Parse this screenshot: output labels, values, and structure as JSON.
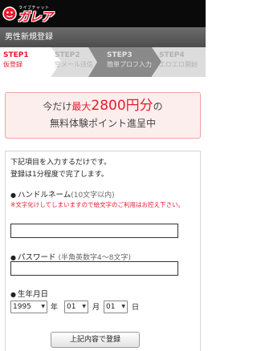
{
  "header": {
    "logo_sub": "ライブチャット",
    "logo_text": "ガレア"
  },
  "title_bar": {
    "title": "男性新規登録"
  },
  "steps": [
    {
      "num": "STEP1",
      "label": "仮登録"
    },
    {
      "num": "STEP2",
      "label": "空メール送信"
    },
    {
      "num": "STEP3",
      "label": "簡単プロフ入力"
    },
    {
      "num": "STEP4",
      "label": "エロエロ開始"
    }
  ],
  "promo": {
    "prefix": "今だけ",
    "max": "最大",
    "amount": "2800円分",
    "suffix": "の",
    "line2": "無料体験ポイント進呈中"
  },
  "form": {
    "intro_line1": "下記項目を入力するだけです。",
    "intro_line2": "登録は1分程度で完了します。",
    "handle_label": "ハンドルネーム",
    "handle_hint": "(10文字以内)",
    "handle_note": "※文字化けしてしまいますので絵文字のご利用はお控え下さい。",
    "handle_value": "",
    "password_label": "パスワード",
    "password_hint": "(半角英数字4〜8文字)",
    "password_value": "",
    "birth_label": "生年月日",
    "birth_year": "1995",
    "birth_year_unit": "年",
    "birth_month": "01",
    "birth_month_unit": "月",
    "birth_day": "01",
    "birth_day_unit": "日",
    "submit_label": "上記内容で登録"
  },
  "colors": {
    "accent": "#e8192c",
    "header_bg": "#0a0a0a",
    "title_bar_bg": "#5a5a5a",
    "promo_bg": "#fdeeee"
  }
}
